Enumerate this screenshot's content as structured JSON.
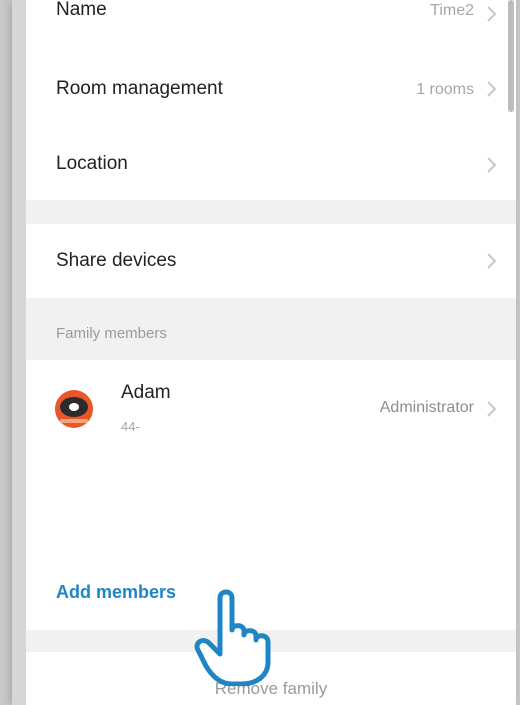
{
  "settings": {
    "name_label": "Name",
    "name_value": "Time2",
    "room_management_label": "Room management",
    "room_management_value": "1 rooms",
    "location_label": "Location",
    "share_devices_label": "Share devices"
  },
  "family_members": {
    "section_label": "Family members",
    "members": [
      {
        "name": "Adam",
        "phone": "44-",
        "role": "Administrator"
      }
    ],
    "add_members_label": "Add members"
  },
  "footer": {
    "remove_family_label": "Remove family"
  },
  "colors": {
    "accent": "#1f86c6",
    "background": "#f1f1f1",
    "avatar": "#e8572a"
  },
  "icons": [
    "chevron-right-icon",
    "robot-avatar-icon",
    "pointing-hand-icon"
  ]
}
